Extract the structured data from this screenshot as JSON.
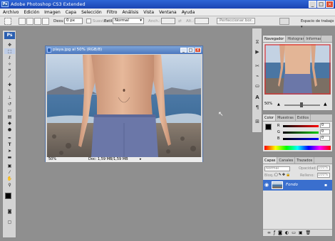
{
  "app": {
    "title": "Adobe Photoshop CS3 Extended",
    "logo": "Ps"
  },
  "window_controls": [
    "_",
    "□",
    "×"
  ],
  "menu": [
    "Archivo",
    "Edición",
    "Imagen",
    "Capa",
    "Selección",
    "Filtro",
    "Análisis",
    "Vista",
    "Ventana",
    "Ayuda"
  ],
  "options": {
    "desv_label": "Desv.:",
    "desv_value": "0 px",
    "suavizar_label": "Suavizar",
    "estilo_label": "Estilo:",
    "estilo_value": "Normal",
    "anch_label": "Anch.:",
    "alt_label": "Alt.:",
    "perfeccionar_label": "Perfeccionar bor.",
    "workspace_label": "Espacio de trabajo"
  },
  "document": {
    "title": "playa.jpg al 50% (RGB/8)",
    "zoom": "50%",
    "status": "Doc: 1,59 MB/1,59 MB"
  },
  "navigator": {
    "tabs": [
      "Navegador",
      "Histograma",
      "Información"
    ],
    "zoom": "50%"
  },
  "color_panel": {
    "tabs": [
      "Color",
      "Muestras",
      "Estilos"
    ],
    "channels": [
      "R",
      "G",
      "B"
    ],
    "values": [
      "0",
      "0",
      "0"
    ]
  },
  "layers_panel": {
    "tabs": [
      "Capas",
      "Canales",
      "Trazados"
    ],
    "blend_mode": "Normal",
    "opacity_label": "Opacidad:",
    "opacity_value": "100%",
    "lock_label": "Bloq.:",
    "fill_label": "Relleno:",
    "fill_value": "100%",
    "layers": [
      {
        "name": "Fondo",
        "visible": true,
        "locked": true
      }
    ]
  },
  "colors": {
    "title_blue": "#1b45b3",
    "layer_selected": "#3a6fce",
    "panel_bg": "#e2e2e2",
    "workspace": "#8f8f8f"
  }
}
